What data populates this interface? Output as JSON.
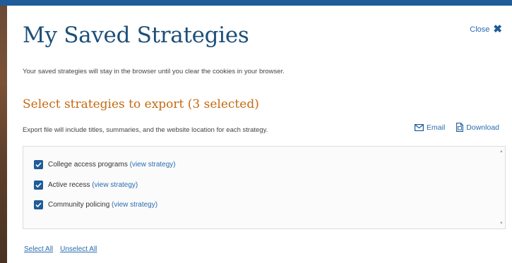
{
  "modal": {
    "title": "My Saved Strategies",
    "close_label": "Close",
    "intro_text": "Your saved strategies will stay in the browser until you clear the cookies in your browser.",
    "subtitle": "Select strategies to export (3 selected)",
    "export_note": "Export file will include titles, summaries, and the website location for each strategy.",
    "actions": {
      "email_label": "Email",
      "download_label": "Download"
    },
    "strategies": [
      {
        "name": "College access programs",
        "link_text": "(view strategy)",
        "checked": true
      },
      {
        "name": "Active recess",
        "link_text": "(view strategy)",
        "checked": true
      },
      {
        "name": "Community policing",
        "link_text": "(view strategy)",
        "checked": true
      }
    ],
    "select_all_label": "Select All",
    "unselect_all_label": "Unselect All"
  },
  "colors": {
    "brand_blue": "#1f5c99",
    "link_blue": "#2a6cb0",
    "accent_orange": "#c46a10"
  },
  "icons": {
    "close": "close-x-icon",
    "email": "envelope-icon",
    "download": "document-download-icon",
    "checkbox": "checkmark-icon"
  }
}
